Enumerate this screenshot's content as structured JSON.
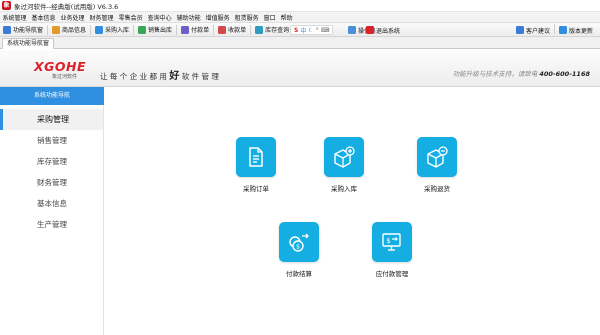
{
  "window": {
    "title": "象过河软件--经典版(试用版) V6.3.6",
    "app_icon": "app-logo-icon"
  },
  "menu": [
    "系统管理",
    "基本信息",
    "业务处理",
    "财务管理",
    "零售会员",
    "查询中心",
    "辅助功能",
    "增值服务",
    "租赁服务",
    "窗口",
    "帮助"
  ],
  "toolbar": {
    "left": [
      {
        "label": "功能导航窗",
        "icon": "home-icon",
        "color": "#3a7bd5"
      },
      {
        "label": "商品信息",
        "icon": "goods-icon",
        "color": "#e39a2a"
      },
      {
        "label": "采购入库",
        "icon": "purchase-in-icon",
        "color": "#2f8fe0"
      },
      {
        "label": "销售出库",
        "icon": "sales-out-icon",
        "color": "#3aa657"
      },
      {
        "label": "付款单",
        "icon": "payment-icon",
        "color": "#6a62c8"
      },
      {
        "label": "收款单",
        "icon": "receipt-icon",
        "color": "#d14b4b"
      },
      {
        "label": "库存查询",
        "icon": "stock-query-icon",
        "color": "#2f9cc0"
      }
    ],
    "right_partial": [
      {
        "label": "操作员",
        "icon": "operator-icon",
        "color": "#4a8fd8"
      },
      {
        "label": "退出系统",
        "icon": "exit-icon",
        "color": "#d9222a"
      }
    ],
    "far_right": [
      {
        "label": "客户建议",
        "icon": "suggestion-icon",
        "color": "#3a7bd5"
      },
      {
        "label": "版本更新",
        "icon": "update-icon",
        "color": "#2f8fe0"
      }
    ],
    "ime": {
      "logo": "S",
      "mode": "中"
    }
  },
  "tabs": [
    "系统功能导航窗"
  ],
  "banner": {
    "logo": "XGOHE",
    "logo_sub": "象过河软件",
    "slogan_before": "让每个企业都用",
    "slogan_big": "好",
    "slogan_after": "软件管理",
    "hotline_label": "功能升级与技术支持，请致电",
    "hotline_number": "400-600-1168"
  },
  "sidebar": {
    "header": "系统功能导航",
    "items": [
      {
        "label": "采购管理",
        "active": true
      },
      {
        "label": "销售管理",
        "active": false
      },
      {
        "label": "库存管理",
        "active": false
      },
      {
        "label": "财务管理",
        "active": false
      },
      {
        "label": "基本信息",
        "active": false
      },
      {
        "label": "生产管理",
        "active": false
      }
    ]
  },
  "functions": [
    {
      "label": "采购订单",
      "icon": "purchase-order-icon"
    },
    {
      "label": "采购入库",
      "icon": "purchase-inbound-icon"
    },
    {
      "label": "采购退货",
      "icon": "purchase-return-icon"
    },
    {
      "label": "付款结算",
      "icon": "payment-settlement-icon"
    },
    {
      "label": "应付款管理",
      "icon": "payable-management-icon"
    }
  ],
  "colors": {
    "accent": "#2f8fe0",
    "tile": "#14aee3",
    "brand_red": "#d9222a"
  }
}
